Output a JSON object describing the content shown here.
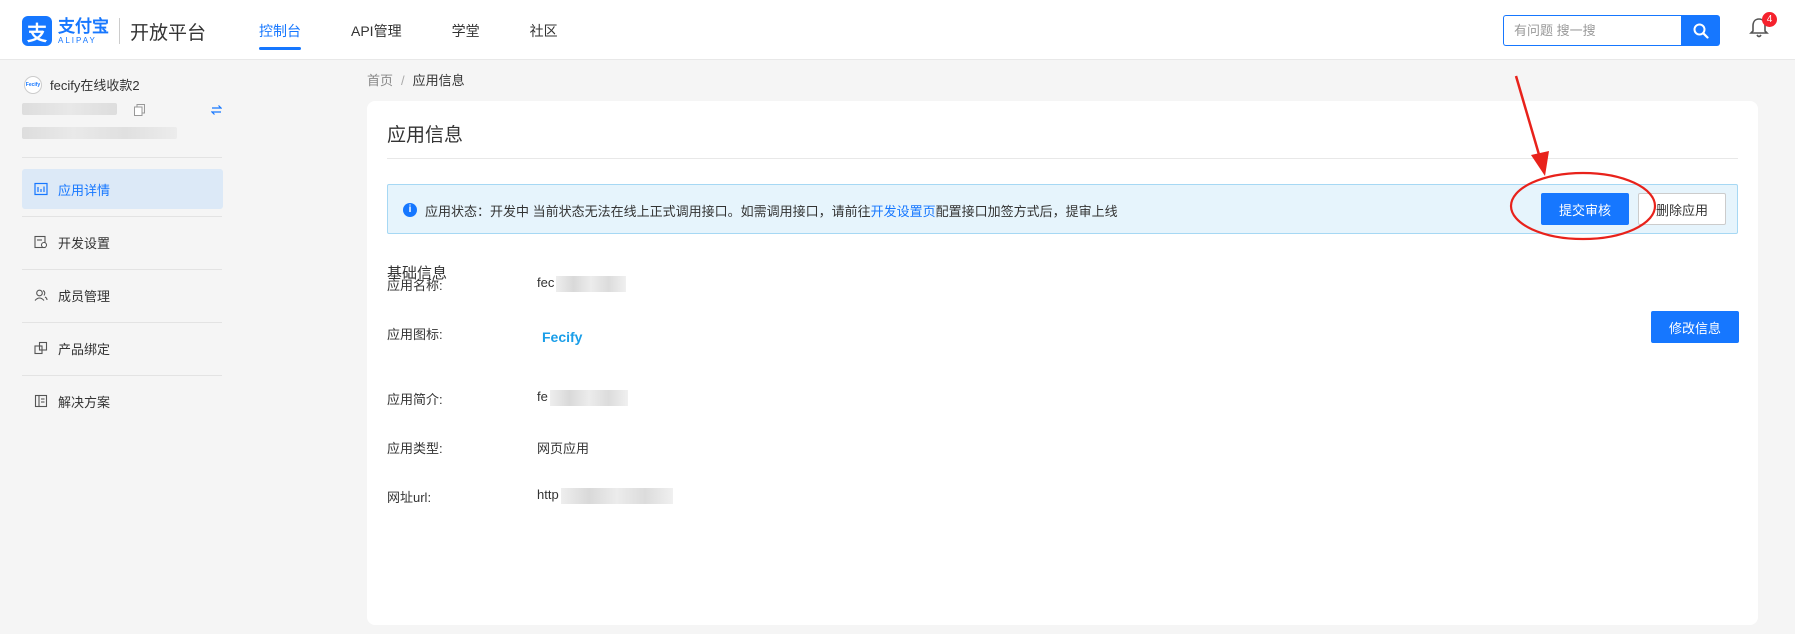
{
  "header": {
    "logo_cn": "支付宝",
    "logo_en": "ALIPAY",
    "logo_mark": "支",
    "platform": "开放平台",
    "nav": [
      {
        "label": "控制台",
        "active": true
      },
      {
        "label": "API管理",
        "active": false
      },
      {
        "label": "学堂",
        "active": false
      },
      {
        "label": "社区",
        "active": false
      }
    ],
    "search_placeholder": "有问题 搜一搜",
    "notification_count": "4"
  },
  "sidebar": {
    "avatar_text": "Fecify",
    "app_name": "fecify在线收款2",
    "menu": [
      {
        "label": "应用详情",
        "icon": "app-detail-icon",
        "active": true
      },
      {
        "label": "开发设置",
        "icon": "dev-settings-icon",
        "active": false
      },
      {
        "label": "成员管理",
        "icon": "members-icon",
        "active": false
      },
      {
        "label": "产品绑定",
        "icon": "product-bind-icon",
        "active": false
      },
      {
        "label": "解决方案",
        "icon": "solution-icon",
        "active": false
      }
    ]
  },
  "breadcrumb": {
    "home": "首页",
    "separator": "/",
    "current": "应用信息"
  },
  "card": {
    "title": "应用信息",
    "alert": {
      "icon": "i",
      "text_before": "应用状态：开发中 当前状态无法在线上正式调用接口。如需调用接口，请前往",
      "link": "开发设置页",
      "text_after": "配置接口加签方式后，提审上线",
      "submit_label": "提交审核",
      "delete_label": "删除应用"
    },
    "section_title": "基础信息",
    "edit_label": "修改信息",
    "fields": [
      {
        "label": "应用名称:",
        "value": "fec"
      },
      {
        "label": "应用图标:",
        "value": "Fecify"
      },
      {
        "label": "应用简介:",
        "value": "fe"
      },
      {
        "label": "应用类型:",
        "value": "网页应用"
      },
      {
        "label": "网址url:",
        "value": "http"
      }
    ]
  },
  "colors": {
    "primary": "#1677ff",
    "annotation": "#e8221b",
    "alert_bg": "#e6f4fc"
  }
}
